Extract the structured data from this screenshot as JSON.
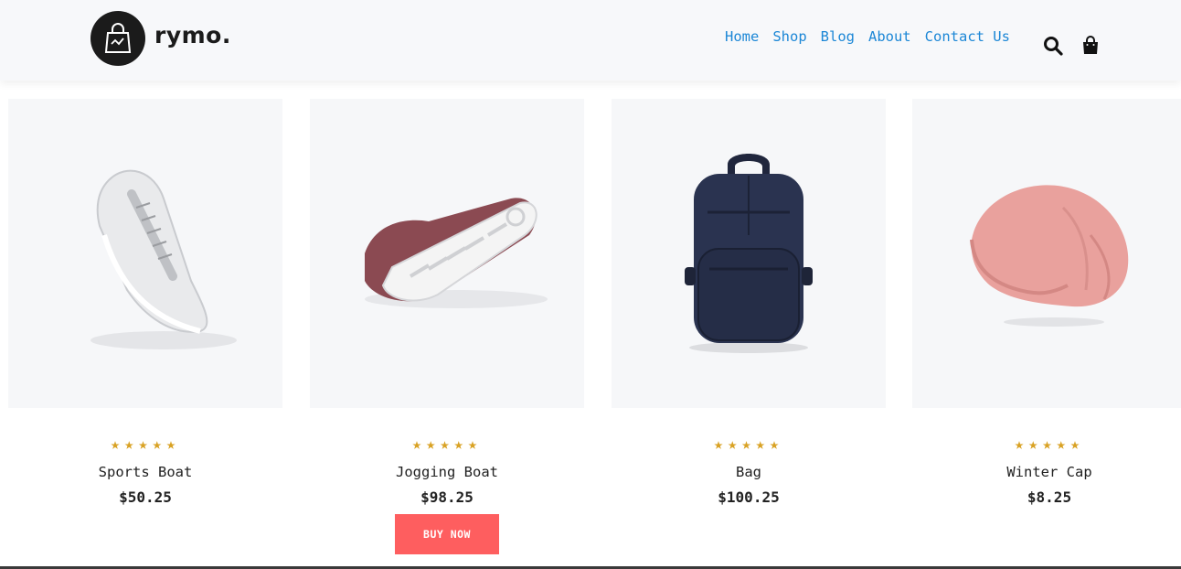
{
  "brand": {
    "name": "rymo.",
    "logo_icon": "shopping-bag-icon"
  },
  "nav": {
    "items": [
      {
        "label": "Home"
      },
      {
        "label": "Shop"
      },
      {
        "label": "Blog"
      },
      {
        "label": "About"
      },
      {
        "label": "Contact Us"
      }
    ],
    "color": "#1c87d6"
  },
  "header_icons": {
    "search": "search-icon",
    "cart": "shopping-bag-icon"
  },
  "products": [
    {
      "name": "Sports Boat",
      "price": "$50.25",
      "stars": "★★★★★",
      "rating": 5,
      "image": "white-sneaker"
    },
    {
      "name": "Jogging Boat",
      "price": "$98.25",
      "stars": "★★★★★",
      "rating": 5,
      "image": "maroon-sneaker",
      "button": "BUY NOW"
    },
    {
      "name": "Bag",
      "price": "$100.25",
      "stars": "★★★★★",
      "rating": 5,
      "image": "navy-backpack"
    },
    {
      "name": "Winter Cap",
      "price": "$8.25",
      "stars": "★★★★★",
      "rating": 5,
      "image": "pink-beanie"
    }
  ],
  "colors": {
    "star": "#d9a224",
    "buy_button": "#fe5e5f",
    "card_bg": "#f6f7f9"
  }
}
